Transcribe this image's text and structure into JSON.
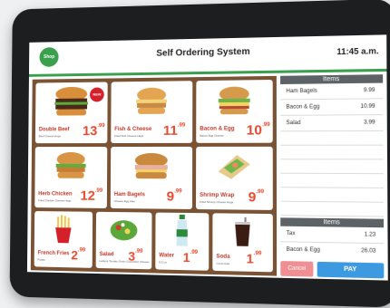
{
  "header": {
    "logo_text": "Shop",
    "title": "Self Ordering System",
    "time": "11:45 a.m."
  },
  "menu": {
    "row1": [
      {
        "name": "Double Beef",
        "desc": "Beef Cheese Hugs",
        "price_main": "13",
        "price_cents": ".99",
        "badge": "NEW"
      },
      {
        "name": "Fish & Cheese",
        "desc": "Fried Fish Cheese Hugs",
        "price_main": "11",
        "price_cents": ".99"
      },
      {
        "name": "Bacon & Egg",
        "desc": "Bacon Egg Cheese",
        "price_main": "10",
        "price_cents": ".99"
      }
    ],
    "row2": [
      {
        "name": "Herb Chicken",
        "desc": "Fried Chicken Cheese Hugs",
        "price_main": "12",
        "price_cents": ".99"
      },
      {
        "name": "Ham Bagels",
        "desc": "Cheese Egg Ham",
        "price_main": "9",
        "price_cents": ".99"
      },
      {
        "name": "Shrimp Wrap",
        "desc": "Fried Shrimp Cheese Hugs",
        "price_main": "9",
        "price_cents": ".99"
      }
    ],
    "row3": [
      {
        "name": "French Fries",
        "desc": "Potato",
        "price_main": "2",
        "price_cents": ".99"
      },
      {
        "name": "Salad",
        "desc": "Lettuce Tomato Onion Cucumber Cheese",
        "price_main": "3",
        "price_cents": ".99"
      },
      {
        "name": "Water",
        "desc": "0.5 Ltr",
        "price_main": "1",
        "price_cents": ".99"
      },
      {
        "name": "Soda",
        "desc": "Coca Cola",
        "price_main": "1",
        "price_cents": ".99"
      }
    ]
  },
  "order": {
    "items_header": "Items",
    "items": [
      {
        "name": "Ham Bagels",
        "price": "9.99"
      },
      {
        "name": "Bacon & Egg",
        "price": "10.99"
      },
      {
        "name": "Salad",
        "price": "3.99"
      }
    ],
    "totals_header": "Items",
    "tax_label": "Tax",
    "tax_value": "1.23",
    "total_label": "Bacon & Egg",
    "total_value": "26.03",
    "cancel_label": "Cancel",
    "pay_label": "PAY"
  },
  "colors": {
    "accent": "#3aa04d",
    "menu_bg": "#7a5234",
    "price": "#e84a2f",
    "pay": "#3d9ae0",
    "cancel": "#ef8f94"
  }
}
